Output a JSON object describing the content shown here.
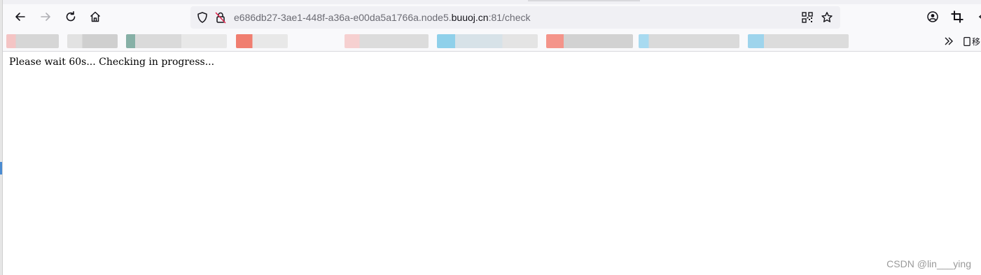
{
  "browser": {
    "url_prefix": "e686db27-3ae1-448f-a36a-e00da5a1766a.node5.",
    "url_domain": "buuoj.cn",
    "url_suffix": ":81/check",
    "overflow_bookmark_label": "移"
  },
  "page": {
    "message": "Please wait 60s... Checking in progress..."
  },
  "watermark": "CSDN @lin___ying",
  "icons": {
    "back": "back-arrow-icon",
    "forward": "forward-arrow-icon",
    "reload": "reload-icon",
    "home": "home-icon",
    "shield": "tracking-protection-icon",
    "insecure": "insecure-lock-icon",
    "qr": "qr-code-icon",
    "star": "bookmark-star-icon",
    "account": "account-icon",
    "crop": "crop-icon",
    "overflow": "chevron-double-right-icon",
    "mobile": "mobile-bookmarks-icon"
  },
  "colors": {
    "chrome_bg": "#f9f9fb",
    "url_bg": "#f0f0f4",
    "page_text": "#000000",
    "watermark": "#9a9a9a"
  }
}
